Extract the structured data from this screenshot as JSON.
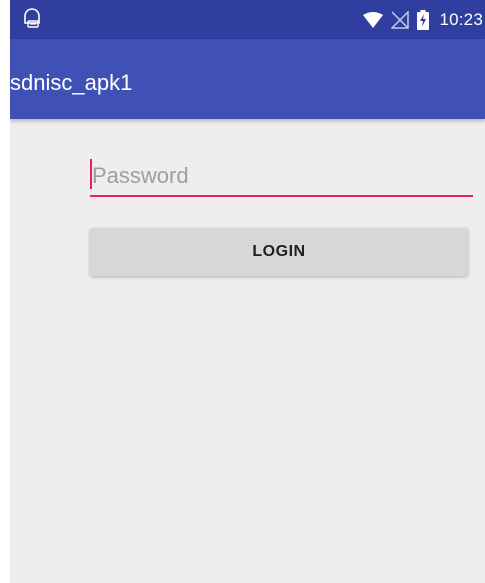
{
  "status_bar": {
    "notification_icon": "android-debug-icon",
    "wifi_icon": "wifi-full-icon",
    "signal_icon": "cell-signal-off-icon",
    "battery_icon": "battery-charging-icon",
    "time": "10:23"
  },
  "app_bar": {
    "title": "sdnisc_apk1",
    "color": "#3f51b5"
  },
  "login_form": {
    "password": {
      "placeholder": "Password",
      "value": ""
    },
    "login_label": "LOGIN",
    "accent_color": "#e91e63"
  }
}
